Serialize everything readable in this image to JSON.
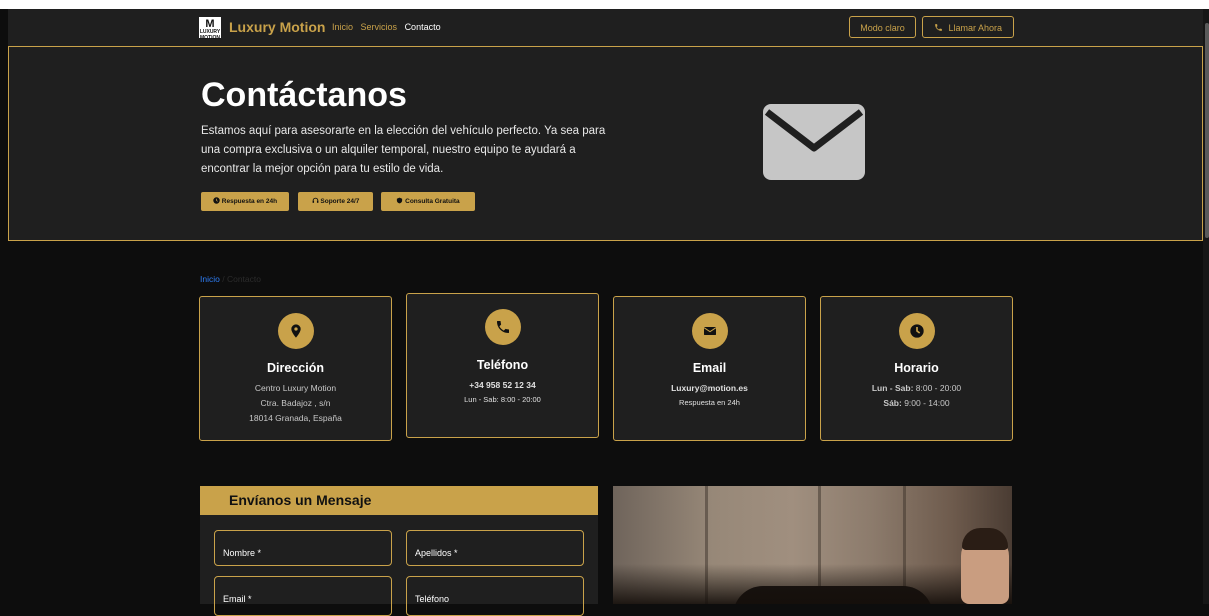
{
  "nav": {
    "logo_text": "M LUXURY MOTION",
    "brand": "Luxury Motion",
    "links": [
      "Inicio",
      "Servicios",
      "Contacto"
    ],
    "theme_button": "Modo claro",
    "call_button": "Llamar Ahora"
  },
  "hero": {
    "title": "Contáctanos",
    "description": "Estamos aquí para asesorarte en la elección del vehículo perfecto. Ya sea para una compra exclusiva o un alquiler temporal, nuestro equipo te ayudará a encontrar la mejor opción para tu estilo de vida.",
    "badges": [
      "Respuesta en 24h",
      "Soporte 24/7",
      "Consulta Gratuita"
    ]
  },
  "breadcrumb": {
    "home": "Inicio",
    "separator": "/",
    "current": "Contacto"
  },
  "cards": [
    {
      "icon": "map-pin-icon",
      "title": "Dirección",
      "lines": [
        "Centro Luxury Motion",
        "Ctra. Badajoz , s/n",
        "18014 Granada, España"
      ]
    },
    {
      "icon": "phone-icon",
      "title": "Teléfono",
      "phone": "+34 958 52 12 34",
      "hours": "Lun - Sab: 8:00 - 20:00"
    },
    {
      "icon": "envelope-icon",
      "title": "Email",
      "email": "Luxury@motion.es",
      "note": "Respuesta en 24h"
    },
    {
      "icon": "clock-icon",
      "title": "Horario",
      "weekday_label": "Lun - Sab:",
      "weekday_hours": "8:00 - 20:00",
      "saturday_label": "Sáb:",
      "saturday_hours": "9:00 - 14:00"
    }
  ],
  "form": {
    "title": "Envíanos un Mensaje",
    "fields": {
      "nombre": "Nombre *",
      "apellidos": "Apellidos *",
      "email": "Email *",
      "telefono": "Teléfono"
    }
  },
  "colors": {
    "gold": "#c9a24a",
    "panel": "#1f1f1f",
    "background": "#0d0d0d",
    "link_blue": "#2f7ef5"
  }
}
